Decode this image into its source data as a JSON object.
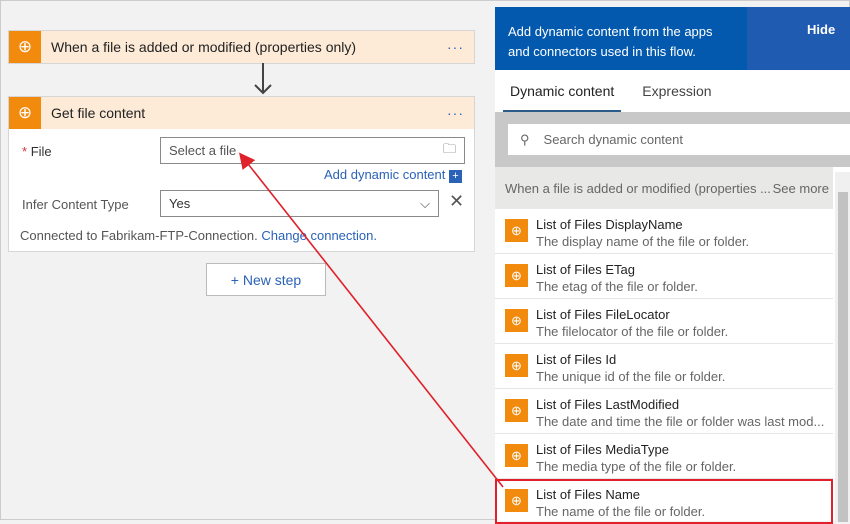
{
  "trigger": {
    "title": "When a file is added or modified (properties only)",
    "menu": "···"
  },
  "action": {
    "title": "Get file content",
    "menu": "···",
    "file_label": "File",
    "required_mark": "*",
    "file_placeholder": "Select a file",
    "add_dynamic": "Add dynamic content",
    "infer_label": "Infer Content Type",
    "infer_value": "Yes",
    "connected": "Connected to Fabrikam-FTP-Connection.",
    "change": "Change connection."
  },
  "new_step": "+ New step",
  "panel": {
    "message": "Add dynamic content from the apps and connectors used in this flow.",
    "hide": "Hide",
    "tabs": [
      "Dynamic content",
      "Expression"
    ],
    "search_placeholder": "Search dynamic content",
    "section": "When a file is added or modified (properties ...",
    "see_more": "See more",
    "items": [
      {
        "title": "List of Files DisplayName",
        "desc": "The display name of the file or folder."
      },
      {
        "title": "List of Files ETag",
        "desc": "The etag of the file or folder."
      },
      {
        "title": "List of Files FileLocator",
        "desc": "The filelocator of the file or folder."
      },
      {
        "title": "List of Files Id",
        "desc": "The unique id of the file or folder."
      },
      {
        "title": "List of Files LastModified",
        "desc": "The date and time the file or folder was last mod..."
      },
      {
        "title": "List of Files MediaType",
        "desc": "The media type of the file or folder."
      },
      {
        "title": "List of Files Name",
        "desc": "The name of the file or folder."
      }
    ]
  },
  "colors": {
    "accent": "#0359ad",
    "connector": "#f28a0e",
    "annotation": "#e0202a"
  }
}
